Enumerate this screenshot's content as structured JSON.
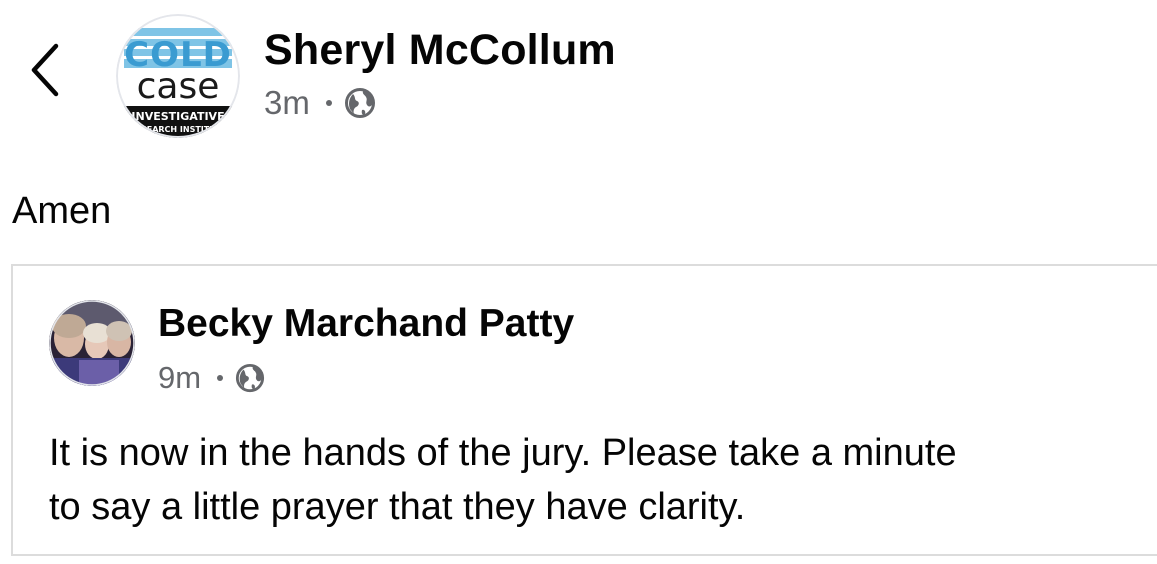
{
  "post": {
    "author": "Sheryl McCollum",
    "time": "3m",
    "audience_icon": "globe-icon",
    "text": "Amen"
  },
  "page_avatar": {
    "logo_word_1": "COLD",
    "logo_word_2": "case",
    "logo_line_1": "INVESTIGATIVE",
    "logo_line_2": "RESEARCH INSTITUTE"
  },
  "shared_post": {
    "author": "Becky Marchand Patty",
    "time": "9m",
    "audience_icon": "globe-icon",
    "lines": [
      "It is now in the hands of the jury. Please take a minute",
      "to say a little prayer that they have clarity."
    ]
  },
  "colors": {
    "text": "#050505",
    "meta": "#65676b",
    "logo_blue": "#3a9bd1",
    "card_border": "#dcdcdc"
  }
}
